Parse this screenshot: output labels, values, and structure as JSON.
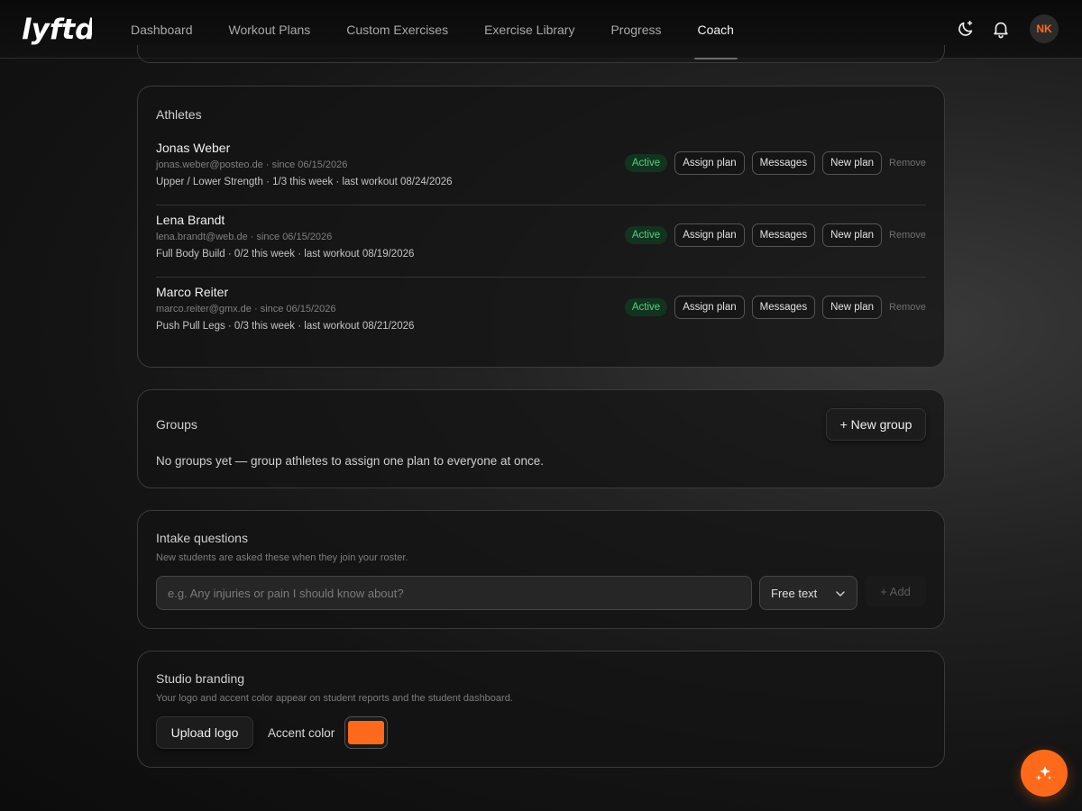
{
  "brand": {
    "name": "lyftd"
  },
  "nav": {
    "items": [
      {
        "label": "Dashboard"
      },
      {
        "label": "Workout Plans"
      },
      {
        "label": "Custom Exercises"
      },
      {
        "label": "Exercise Library"
      },
      {
        "label": "Progress"
      },
      {
        "label": "Coach",
        "active": true
      }
    ]
  },
  "user": {
    "initials": "NK"
  },
  "athletes": {
    "title": "Athletes",
    "items": [
      {
        "name": "Jonas Weber",
        "meta": "jonas.weber@posteo.de · since 06/15/2026",
        "plan": "Upper / Lower Strength · 1/3 this week · last workout 08/24/2026",
        "status": "Active"
      },
      {
        "name": "Lena Brandt",
        "meta": "lena.brandt@web.de · since 06/15/2026",
        "plan": "Full Body Build · 0/2 this week · last workout 08/19/2026",
        "status": "Active"
      },
      {
        "name": "Marco Reiter",
        "meta": "marco.reiter@gmx.de · since 06/15/2026",
        "plan": "Push Pull Legs · 0/3 this week · last workout 08/21/2026",
        "status": "Active"
      }
    ],
    "actions": {
      "assign": "Assign plan",
      "messages": "Messages",
      "new_plan": "New plan",
      "remove": "Remove"
    }
  },
  "groups": {
    "title": "Groups",
    "new_button": "+ New group",
    "empty": "No groups yet — group athletes to assign one plan to everyone at once."
  },
  "intake": {
    "title": "Intake questions",
    "subtitle": "New students are asked these when they join your roster.",
    "placeholder": "e.g. Any injuries or pain I should know about?",
    "type_selected": "Free text",
    "add_button": "+ Add"
  },
  "branding": {
    "title": "Studio branding",
    "subtitle": "Your logo and accent color appear on student reports and the student dashboard.",
    "upload_button": "Upload logo",
    "accent_label": "Accent color",
    "accent_color": "#ff6a1a"
  },
  "colors": {
    "accent": "#ff6a1a",
    "active_badge_text": "#4fd37f",
    "active_badge_bg": "#12331f"
  },
  "icons": {
    "theme_toggle": "moon-sparkle-icon",
    "notifications": "bell-icon",
    "chevron": "chevron-down-icon",
    "fab": "sparkles-icon"
  }
}
